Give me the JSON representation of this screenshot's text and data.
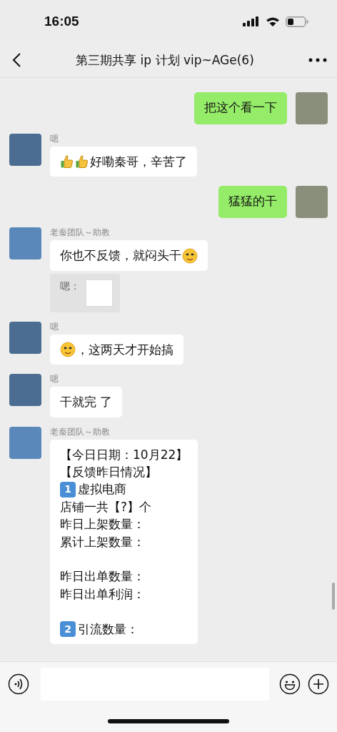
{
  "status_bar": {
    "time": "16:05"
  },
  "header": {
    "title": "第三期共享 ip 计划 vip~AGe(6)"
  },
  "messages": [
    {
      "kind": "outgoing",
      "paragraphs": [
        [
          [
            {
              "kind": "text",
              "text": "把这个看一下"
            }
          ]
        ]
      ]
    },
    {
      "kind": "incoming",
      "color": "#4b6d92",
      "sender": "嗯",
      "paragraphs": [
        [
          [
            {
              "kind": "thumbs"
            },
            {
              "kind": "thumbs"
            },
            {
              "kind": "text",
              "text": "好嘞秦哥，辛苦了"
            }
          ]
        ]
      ]
    },
    {
      "kind": "outgoing",
      "paragraphs": [
        [
          [
            {
              "kind": "text",
              "text": "猛猛的干"
            }
          ]
        ]
      ]
    },
    {
      "kind": "incoming",
      "color": "#5b88bb",
      "sender": "老秦团队～助教",
      "paragraphs": [
        [
          [
            {
              "kind": "text",
              "text": "你也不反馈，就闷头干"
            },
            {
              "kind": "face"
            }
          ]
        ]
      ],
      "quote": {
        "text": "嗯："
      }
    },
    {
      "kind": "incoming",
      "color": "#4b6d92",
      "sender": "嗯",
      "paragraphs": [
        [
          [
            {
              "kind": "face"
            },
            {
              "kind": "text",
              "text": "，这两天才开始搞"
            }
          ]
        ]
      ]
    },
    {
      "kind": "incoming",
      "color": "#4b6d92",
      "sender": "嗯",
      "paragraphs": [
        [
          [
            {
              "kind": "text",
              "text": "干就完 了"
            }
          ]
        ]
      ]
    },
    {
      "kind": "incoming",
      "color": "#5b88bb",
      "sender": "老秦团队～助教",
      "paragraphs": [
        [
          [
            {
              "kind": "text",
              "text": "【今日日期：10月22】"
            }
          ],
          [
            {
              "kind": "text",
              "text": "【反馈昨日情况】"
            }
          ],
          [
            {
              "kind": "keycap",
              "text": "1"
            },
            {
              "kind": "text",
              "text": "虚拟电商"
            }
          ],
          [
            {
              "kind": "text",
              "text": "店铺一共【?】个"
            }
          ],
          [
            {
              "kind": "text",
              "text": "昨日上架数量："
            }
          ],
          [
            {
              "kind": "text",
              "text": "累计上架数量："
            }
          ]
        ],
        [
          [
            {
              "kind": "text",
              "text": "昨日出单数量："
            }
          ],
          [
            {
              "kind": "text",
              "text": "昨日出单利润："
            }
          ]
        ],
        [
          [
            {
              "kind": "keycap",
              "text": "2"
            },
            {
              "kind": "text",
              "text": "引流数量："
            }
          ]
        ]
      ]
    }
  ]
}
